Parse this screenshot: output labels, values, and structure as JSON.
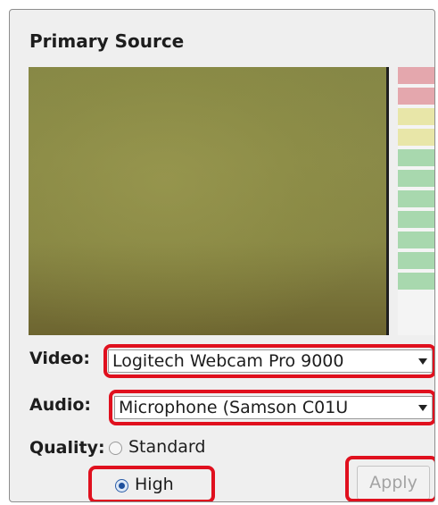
{
  "panel": {
    "title": "Primary Source"
  },
  "video": {
    "label": "Video:",
    "selected": "Logitech Webcam Pro 9000"
  },
  "audio": {
    "label": "Audio:",
    "selected": "Microphone (Samson C01U"
  },
  "quality": {
    "label": "Quality:",
    "options": [
      {
        "label": "Standard",
        "checked": false
      },
      {
        "label": "High",
        "checked": true
      }
    ]
  },
  "apply": {
    "label": "Apply",
    "enabled": false
  },
  "level_meter": {
    "segment_colors": [
      "#e4a7ad",
      "#e4a7ad",
      "#e8e6a8",
      "#e8e6a8",
      "#a8d8ae",
      "#a8d8ae",
      "#a8d8ae",
      "#a8d8ae",
      "#a8d8ae",
      "#a8d8ae",
      "#a8d8ae"
    ]
  },
  "colors": {
    "highlight": "#e0101e",
    "panel_bg": "#efefef"
  }
}
